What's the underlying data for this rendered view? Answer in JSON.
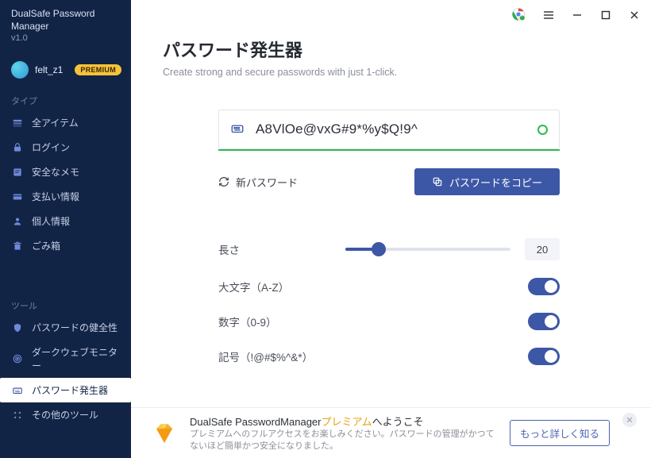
{
  "app": {
    "name": "DualSafe Password Manager",
    "version": "v1.0"
  },
  "user": {
    "name": "felt_z1",
    "badge": "PREMIUM"
  },
  "sidebar": {
    "section_types": "タイプ",
    "section_tools": "ツール",
    "types": [
      {
        "icon": "stack",
        "label": "全アイテム"
      },
      {
        "icon": "lock",
        "label": "ログイン"
      },
      {
        "icon": "note",
        "label": "安全なメモ"
      },
      {
        "icon": "card",
        "label": "支払い情報"
      },
      {
        "icon": "person",
        "label": "個人情報"
      },
      {
        "icon": "trash",
        "label": "ごみ箱"
      }
    ],
    "tools": [
      {
        "icon": "shield",
        "label": "パスワードの健全性"
      },
      {
        "icon": "radar",
        "label": "ダークウェブモニター"
      },
      {
        "icon": "keybd",
        "label": "パスワード発生器",
        "active": true
      },
      {
        "icon": "dots",
        "label": "その他のツール"
      }
    ]
  },
  "page": {
    "title": "パスワード発生器",
    "subtitle": "Create strong and secure passwords with just 1-click."
  },
  "generator": {
    "password": "A8VlOe@vxG#9*%y$Q!9^",
    "refresh_label": "新パスワード",
    "copy_label": "パスワードをコピー",
    "length_label": "長さ",
    "length_value": "20",
    "opt_upper": "大文字（A-Z）",
    "opt_digits": "数字（0-9）",
    "opt_symbols": "記号（!@#$%^&*）"
  },
  "banner": {
    "title_prefix": "DualSafe PasswordManager",
    "title_highlight": "プレミアム",
    "title_suffix": "へようこそ",
    "subtitle": "プレミアムへのフルアクセスをお楽しみください。パスワードの管理がかつてないほど簡単かつ安全になりました。",
    "cta": "もっと詳しく知る"
  }
}
